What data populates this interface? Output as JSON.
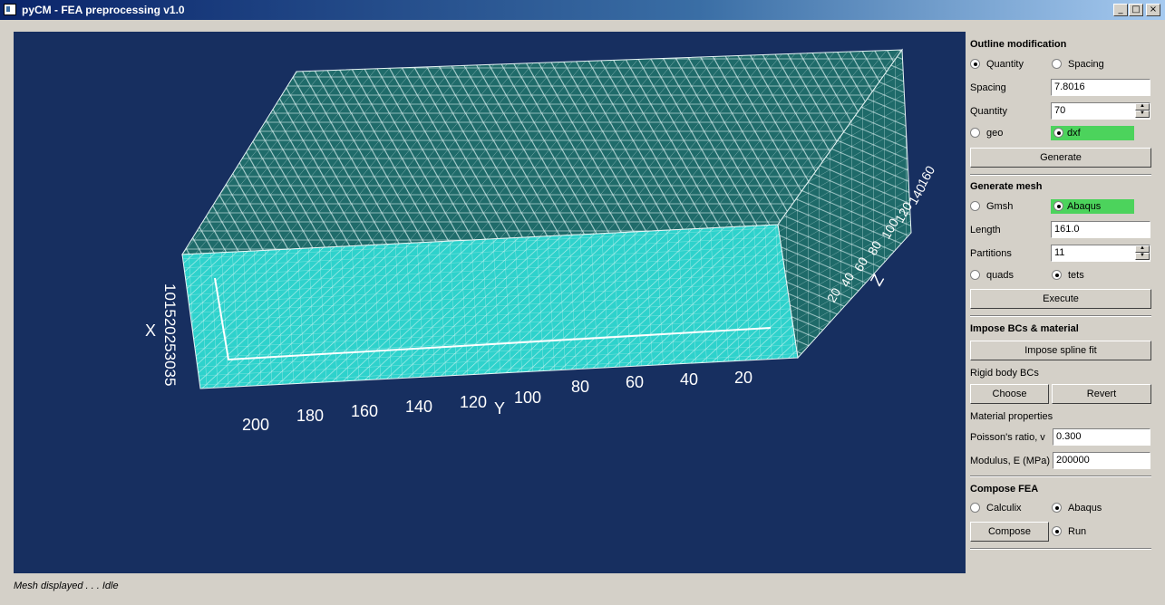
{
  "window": {
    "title": "pyCM - FEA preprocessing v1.0",
    "minimize_glyph": "_",
    "maximize_glyph": "□",
    "close_glyph": "×"
  },
  "viewport": {
    "background": "#172f60",
    "mesh_color": "#2ed2cc",
    "axis_labels": {
      "x": "X",
      "y": "Y",
      "z": "Z"
    },
    "y_ticks": [
      "200",
      "180",
      "160",
      "140",
      "120",
      "100",
      "80",
      "60",
      "40",
      "20"
    ],
    "z_ticks": [
      "20",
      "40",
      "60",
      "80",
      "100",
      "120",
      "140",
      "160"
    ],
    "x_ticks_overlap": "101520253035"
  },
  "panel": {
    "outline": {
      "title": "Outline modification",
      "radio_quantity": "Quantity",
      "radio_spacing": "Spacing",
      "spacing_label": "Spacing",
      "spacing_value": "7.8016",
      "quantity_label": "Quantity",
      "quantity_value": "70",
      "radio_geo": "geo",
      "radio_dxf": "dxf",
      "generate_button": "Generate"
    },
    "mesh": {
      "title": "Generate mesh",
      "radio_gmsh": "Gmsh",
      "radio_abaqus": "Abaqus",
      "length_label": "Length",
      "length_value": "161.0",
      "partitions_label": "Partitions",
      "partitions_value": "11",
      "radio_quads": "quads",
      "radio_tets": "tets",
      "execute_button": "Execute"
    },
    "bcs": {
      "title": "Impose BCs & material",
      "spline_button": "Impose spline fit",
      "rigid_label": "Rigid body BCs",
      "choose_button": "Choose",
      "revert_button": "Revert",
      "material_label": "Material properties",
      "poisson_label": "Poisson's ratio, v",
      "poisson_value": "0.300",
      "modulus_label": "Modulus, E (MPa)",
      "modulus_value": "200000"
    },
    "fea": {
      "title": "Compose FEA",
      "radio_calculix": "Calculix",
      "radio_abaqus": "Abaqus",
      "compose_button": "Compose",
      "run_label": "Run"
    }
  },
  "status": {
    "text": "Mesh displayed . . . Idle"
  }
}
